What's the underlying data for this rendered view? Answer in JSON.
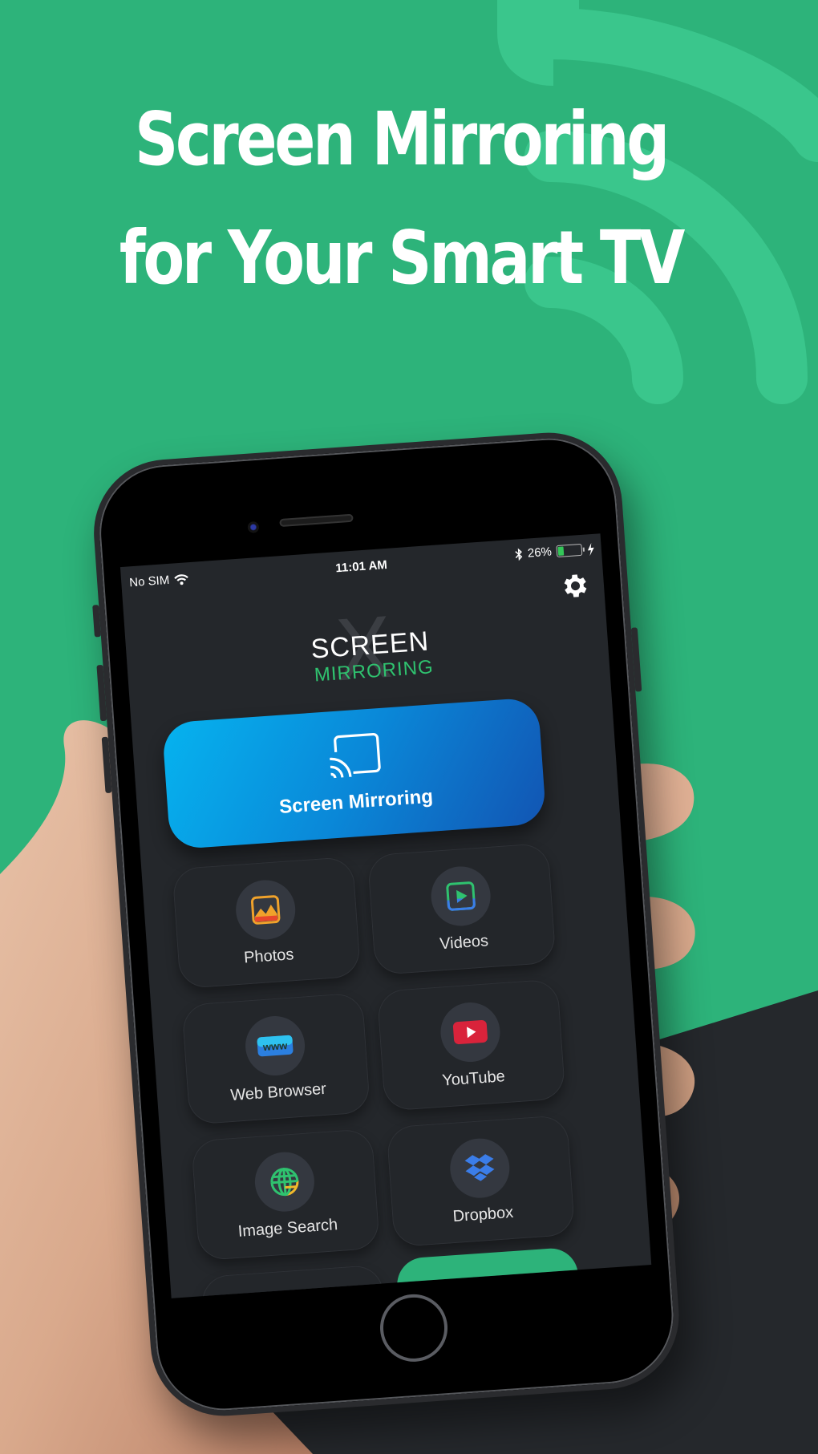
{
  "headline": {
    "line1": "Screen Mirroring",
    "line2": "for Your Smart TV"
  },
  "colors": {
    "brand_green": "#2db37a",
    "arc_green": "#3ac68c",
    "dark_bg": "#25282c",
    "button_blue_start": "#06b3ef",
    "button_blue_end": "#1255b3"
  },
  "status_bar": {
    "carrier": "No SIM",
    "wifi_icon": "wifi-icon",
    "time": "11:01 AM",
    "bluetooth_icon": "bluetooth-icon",
    "battery_percent": "26%",
    "battery_level": 0.26,
    "charging_icon": "bolt-icon"
  },
  "app": {
    "settings_icon": "gear-icon",
    "logo": {
      "mark": "X",
      "line1": "SCREEN",
      "line2": "MIRRORING"
    },
    "primary_button": {
      "label": "Screen Mirroring",
      "icon": "cast-icon"
    },
    "tiles": [
      {
        "label": "Photos",
        "icon": "photos-icon"
      },
      {
        "label": "Videos",
        "icon": "video-play-icon"
      },
      {
        "label": "Web Browser",
        "icon": "www-icon"
      },
      {
        "label": "YouTube",
        "icon": "youtube-icon"
      },
      {
        "label": "Image Search",
        "icon": "globe-icon"
      },
      {
        "label": "Dropbox",
        "icon": "dropbox-icon"
      }
    ]
  }
}
